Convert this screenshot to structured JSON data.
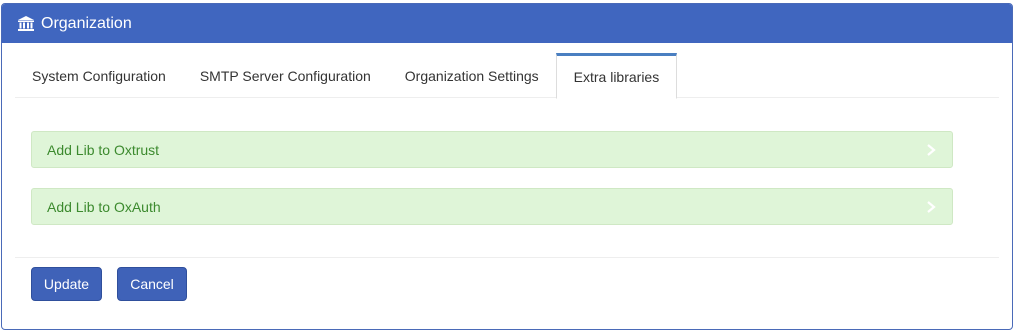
{
  "panel": {
    "title": "Organization",
    "icon": "bank-icon"
  },
  "tabs": [
    {
      "label": "System Configuration",
      "active": false
    },
    {
      "label": "SMTP Server Configuration",
      "active": false
    },
    {
      "label": "Organization Settings",
      "active": false
    },
    {
      "label": "Extra libraries",
      "active": true
    }
  ],
  "accordion": {
    "items": [
      {
        "label": "Add Lib to Oxtrust",
        "icon": "chevron-right-icon"
      },
      {
        "label": "Add Lib to OxAuth",
        "icon": "chevron-right-icon"
      }
    ]
  },
  "actions": {
    "update_label": "Update",
    "cancel_label": "Cancel"
  },
  "colors": {
    "header_bg": "#4066bf",
    "accordion_bg": "#dff5d8",
    "accordion_text": "#3c8a2e",
    "button_bg": "#3f62b8",
    "active_tab_border": "#4a7fc1"
  }
}
